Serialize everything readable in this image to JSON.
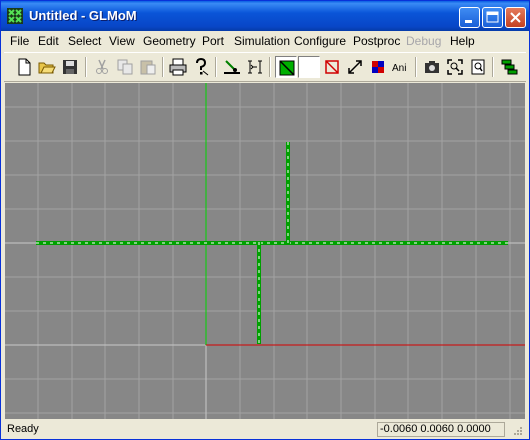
{
  "window": {
    "title": "Untitled - GLMoM"
  },
  "menu": {
    "items": [
      {
        "label": "File",
        "enabled": true
      },
      {
        "label": "Edit",
        "enabled": true
      },
      {
        "label": "Select",
        "enabled": true
      },
      {
        "label": "View",
        "enabled": true
      },
      {
        "label": "Geometry",
        "enabled": true
      },
      {
        "label": "Port",
        "enabled": true
      },
      {
        "label": "Simulation",
        "enabled": true
      },
      {
        "label": "Configure",
        "enabled": true
      },
      {
        "label": "Postproc",
        "enabled": true
      },
      {
        "label": "Debug",
        "enabled": false
      },
      {
        "label": "Help",
        "enabled": true
      }
    ]
  },
  "toolbar": {
    "buttons": [
      {
        "icon": "new-file-icon"
      },
      {
        "icon": "open-folder-icon"
      },
      {
        "icon": "save-icon"
      },
      {
        "icon": "cut-icon",
        "enabled": false
      },
      {
        "icon": "copy-icon",
        "enabled": false
      },
      {
        "icon": "paste-icon",
        "enabled": false
      },
      {
        "icon": "print-icon"
      },
      {
        "icon": "help-icon"
      },
      {
        "icon": "snap-icon"
      },
      {
        "icon": "port-icon"
      },
      {
        "icon": "solid-view-icon",
        "pressed": true
      },
      {
        "icon": "blank-view-icon"
      },
      {
        "icon": "no-mesh-icon"
      },
      {
        "icon": "zoom-extents-icon"
      },
      {
        "icon": "color-map-icon"
      },
      {
        "icon": "ani-text-icon",
        "label": "Ani"
      },
      {
        "icon": "camera-icon"
      },
      {
        "icon": "zoom-window-icon"
      },
      {
        "icon": "zoom-page-icon"
      },
      {
        "icon": "layers-icon"
      }
    ]
  },
  "status": {
    "text": "Ready",
    "coords": "-0.0060  0.0060  0.0000"
  },
  "colors": {
    "canvas": "#878787",
    "grid": "#a3a3a3",
    "axis_y": "#00d400",
    "axis_x": "#d40000",
    "geometry": "#00a000"
  }
}
